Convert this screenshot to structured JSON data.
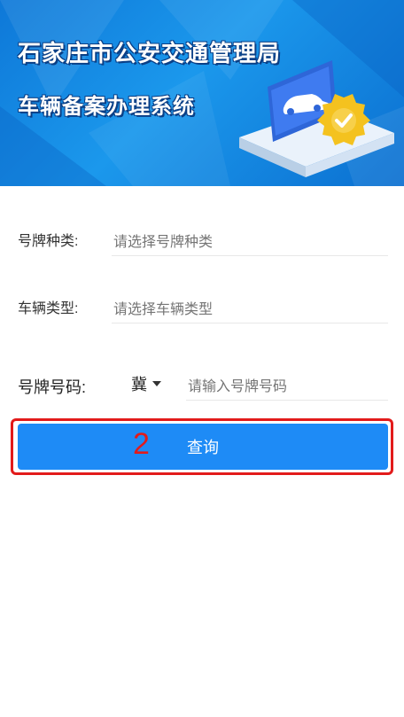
{
  "banner": {
    "title_line1": "石家庄市公安交通管理局",
    "title_line2": "车辆备案办理系统"
  },
  "form": {
    "plate_type": {
      "label": "号牌种类:",
      "placeholder": "请选择号牌种类"
    },
    "vehicle_type": {
      "label": "车辆类型:",
      "placeholder": "请选择车辆类型"
    },
    "plate_number": {
      "label": "号牌号码:",
      "prefix": "冀",
      "placeholder": "请输入号牌号码"
    }
  },
  "query_button": {
    "label": "查询"
  },
  "annotation": {
    "step_number": "2",
    "color": "#e21b1b"
  },
  "colors": {
    "primary": "#1e8bf6",
    "banner": "#1b98ec"
  }
}
